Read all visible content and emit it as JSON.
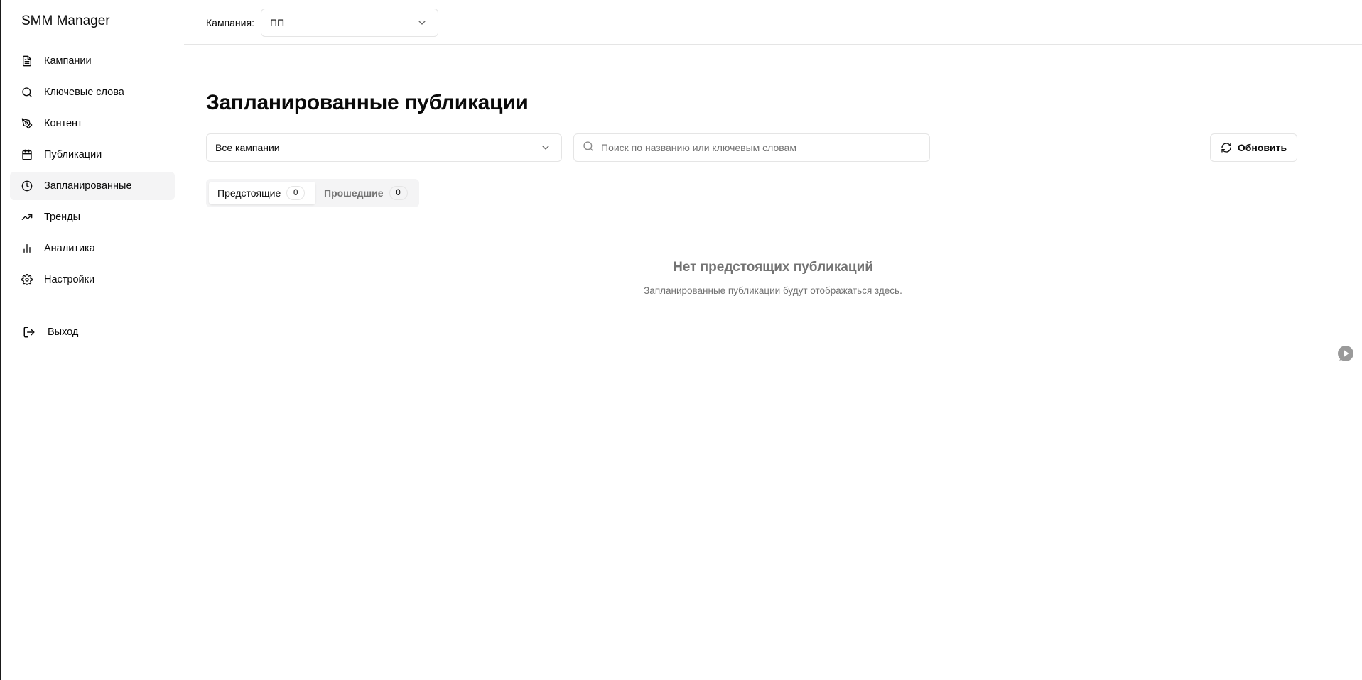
{
  "app": {
    "brand": "SMM Manager"
  },
  "sidebar": {
    "items": [
      {
        "label": "Кампании",
        "icon": "file-text-icon",
        "active": false
      },
      {
        "label": "Ключевые слова",
        "icon": "search-icon",
        "active": false
      },
      {
        "label": "Контент",
        "icon": "pen-tool-icon",
        "active": false
      },
      {
        "label": "Публикации",
        "icon": "calendar-icon",
        "active": false
      },
      {
        "label": "Запланированные",
        "icon": "clock-icon",
        "active": true
      },
      {
        "label": "Тренды",
        "icon": "trending-up-icon",
        "active": false
      },
      {
        "label": "Аналитика",
        "icon": "bar-chart-icon",
        "active": false
      },
      {
        "label": "Настройки",
        "icon": "settings-icon",
        "active": false
      }
    ],
    "logout": {
      "label": "Выход",
      "icon": "log-out-icon"
    }
  },
  "topbar": {
    "campaign_label": "Кампания:",
    "campaign_value": "ПП"
  },
  "main": {
    "title": "Запланированные публикации",
    "filter": {
      "value": "Все кампании"
    },
    "search": {
      "placeholder": "Поиск по названию или ключевым словам",
      "value": ""
    },
    "refresh_label": "Обновить",
    "tabs": [
      {
        "label": "Предстоящие",
        "count": "0",
        "active": true
      },
      {
        "label": "Прошедшие",
        "count": "0",
        "active": false
      }
    ],
    "empty": {
      "title": "Нет предстоящих публикаций",
      "subtitle": "Запланированные публикации будут отображаться здесь."
    }
  },
  "colors": {
    "active_bg": "#f4f4f5",
    "border": "#e5e5e5",
    "muted_text": "#737373",
    "text": "#0a0a0a"
  }
}
